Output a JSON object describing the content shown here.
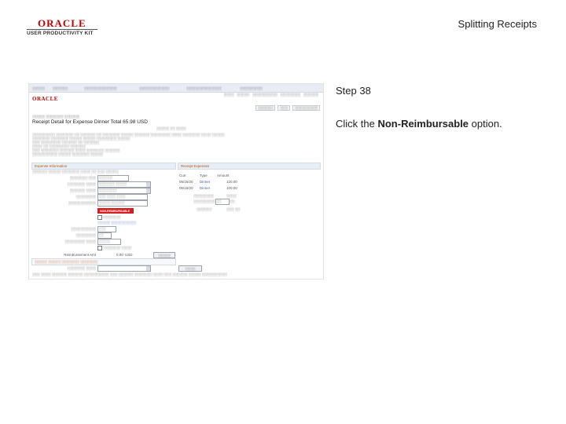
{
  "header": {
    "logo_brand": "ORACLE",
    "logo_product": "USER PRODUCTIVITY KIT",
    "slide_title": "Splitting Receipts"
  },
  "step": {
    "label": "Step 38",
    "instruction_prefix": "Click the ",
    "instruction_target": "Non-Reimbursable",
    "instruction_suffix": " option."
  },
  "screenshot": {
    "brand": "ORACLE",
    "page_title": "Receipt Detail for Expense Dinner   Total 65.98 USD",
    "totals": {
      "col1_header": "Curr",
      "col2_header": "Type",
      "col3_header": "Amount",
      "rows": [
        {
          "c1": "05/15/20",
          "c2": "Dinner",
          "c3": "120.00"
        },
        {
          "c1": "05/15/20",
          "c2": "Dinner",
          "c3": "100.00"
        }
      ]
    },
    "left_section": "Expense Information",
    "right_section": "Receipt Expenses",
    "red_button": "NON-REIMBURSABLE",
    "amount_label": "Reimbursement Amt",
    "amount_value": "0.00",
    "currency": "USD"
  },
  "colors": {
    "brand_red": "#c00000",
    "button_red": "#d21f1f",
    "section_orange": "#b45309"
  }
}
